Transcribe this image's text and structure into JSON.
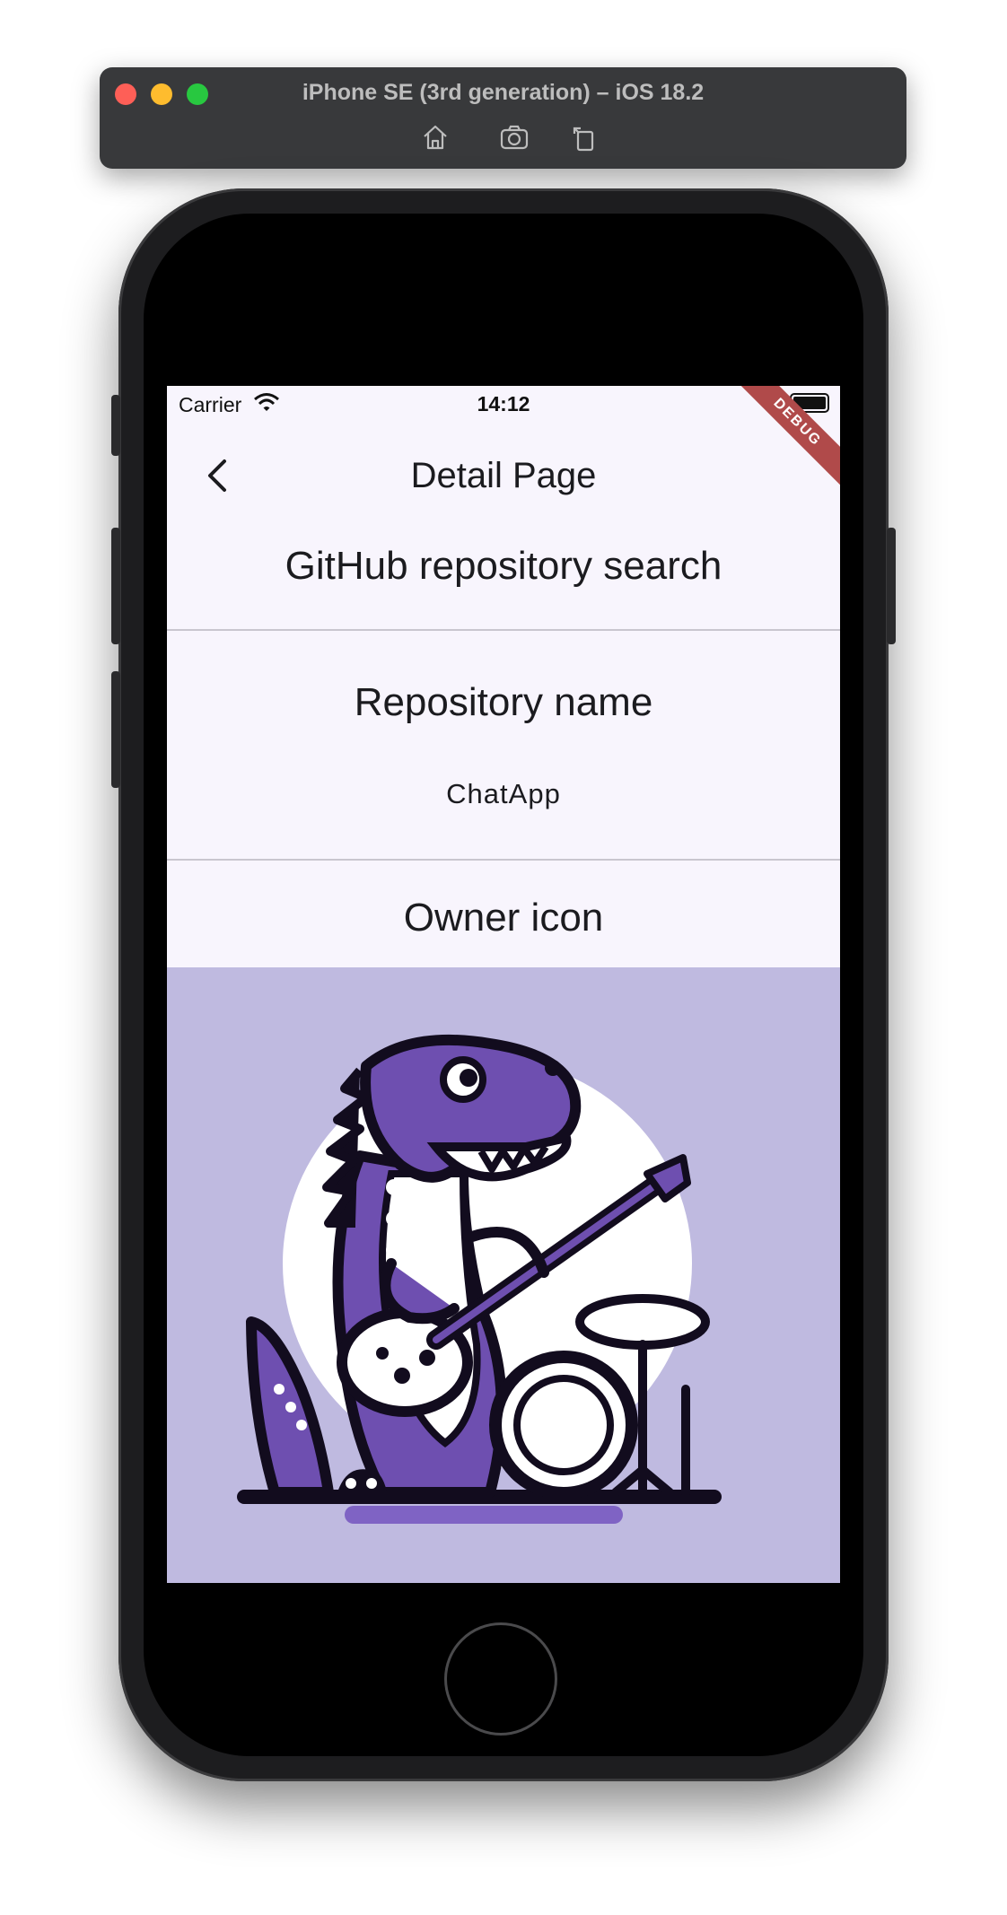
{
  "simulator": {
    "title": "iPhone SE (3rd generation) – iOS 18.2",
    "toolbar": [
      "home-icon",
      "screenshot-icon",
      "rotate-icon"
    ]
  },
  "status_bar": {
    "carrier": "Carrier",
    "time": "14:12"
  },
  "debug_banner": "DEBUG",
  "app_bar": {
    "title": "Detail Page"
  },
  "page": {
    "heading": "GitHub repository search",
    "repository_label": "Repository name",
    "repository_value": "ChatApp",
    "owner_label": "Owner icon"
  },
  "colors": {
    "screen_background": "#f8f5fd",
    "image_background": "#bfbae0",
    "dino_purple": "#6e4fb0",
    "debug_banner": "#b04a4a"
  }
}
